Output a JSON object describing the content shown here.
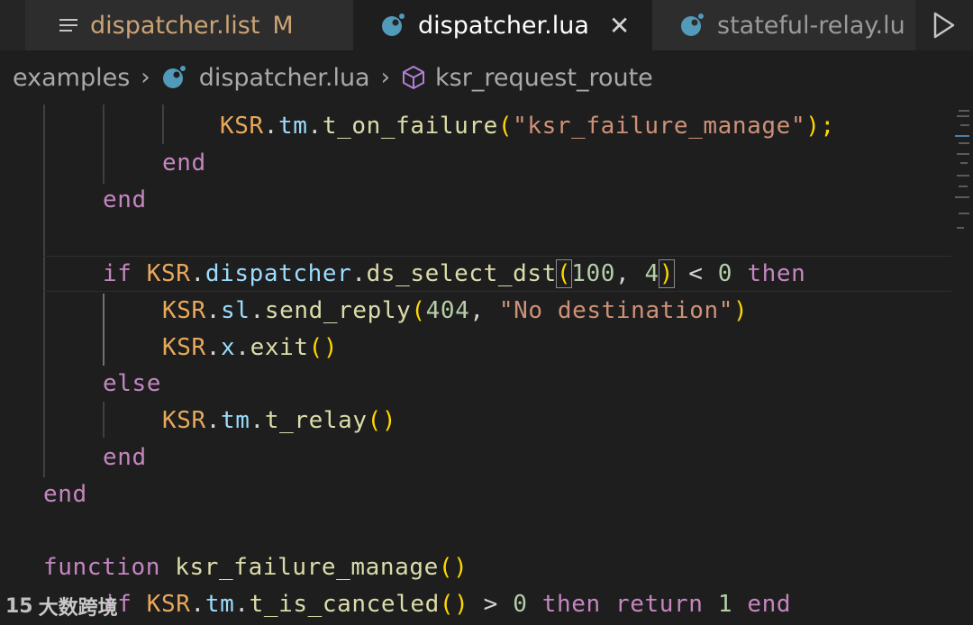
{
  "tabs": [
    {
      "label": "dispatcher.list",
      "status": "M",
      "icon": "list-icon"
    },
    {
      "label": "dispatcher.lua",
      "close": "✕",
      "icon": "lua-icon",
      "active": true
    },
    {
      "label": "stateful-relay.lu",
      "icon": "lua-icon"
    }
  ],
  "run_icon": "play-icon",
  "breadcrumb": {
    "folder": "examples",
    "file": "dispatcher.lua",
    "symbol": "ksr_request_route"
  },
  "code": {
    "l1_obj": "KSR",
    "l1_fld": "tm",
    "l1_fn": "t_on_failure",
    "l1_str": "\"ksr_failure_manage\"",
    "l1_end": ");",
    "l2": "end",
    "l3": "end",
    "l5_kw": "if",
    "l5_obj": "KSR",
    "l5_fld": "dispatcher",
    "l5_fn": "ds_select_dst",
    "l5_n1": "100",
    "l5_n2": "4",
    "l5_op": "<",
    "l5_n3": "0",
    "l5_kw2": "then",
    "l6_obj": "KSR",
    "l6_fld": "sl",
    "l6_fn": "send_reply",
    "l6_n1": "404",
    "l6_str": "\"No destination\"",
    "l7_obj": "KSR",
    "l7_fld": "x",
    "l7_fn": "exit",
    "l8": "else",
    "l9_obj": "KSR",
    "l9_fld": "tm",
    "l9_fn": "t_relay",
    "l10": "end",
    "l11": "end",
    "l13_kw": "function",
    "l13_fn": "ksr_failure_manage",
    "l14_kw": "if",
    "l14_obj": "KSR",
    "l14_fld": "tm",
    "l14_fn": "t_is_canceled",
    "l14_op": ">",
    "l14_n1": "0",
    "l14_kw2": "then",
    "l14_kw3": "return",
    "l14_n2": "1",
    "l14_kw4": "end"
  },
  "watermark": {
    "logo": "15",
    "text": "大数跨境"
  },
  "colors": {
    "keyword": "#c586c0",
    "object": "#e8a85a",
    "field": "#9cdcfe",
    "function": "#dcdcaa",
    "string": "#ce9178",
    "number": "#b5cea8",
    "bracket": "#ffd700",
    "modified": "#cca375"
  }
}
